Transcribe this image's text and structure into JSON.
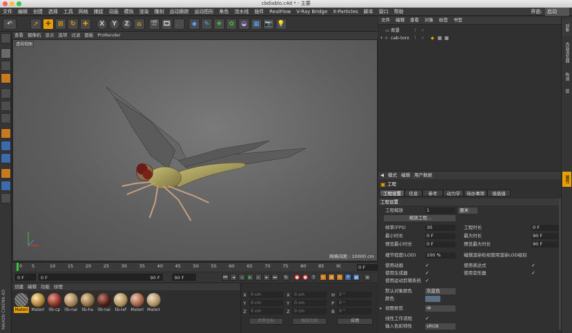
{
  "window": {
    "title": "cbdiablo.c4d * - 主要"
  },
  "menu": [
    "文件",
    "编辑",
    "创建",
    "选择",
    "工具",
    "网格",
    "捕捉",
    "动画",
    "模拟",
    "渲染",
    "雕刻",
    "运动跟踪",
    "运动图形",
    "角色",
    "流水线",
    "插件",
    "RealFlow",
    "V-Ray Bridge",
    "X-Particles",
    "脚本",
    "窗口",
    "帮助"
  ],
  "layout": {
    "label": "界面:",
    "value": "启动"
  },
  "toolbar": {
    "x": "X",
    "y": "Y",
    "z": "Z"
  },
  "viewport": {
    "menu": [
      "查看",
      "摄像机",
      "显示",
      "选项",
      "过滤",
      "面板",
      "ProRender"
    ],
    "label": "透视视图",
    "grid_spacing": "网格间距 : 10000 cm"
  },
  "timeline": {
    "ticks": [
      "0",
      "5",
      "10",
      "15",
      "20",
      "25",
      "30",
      "35",
      "40",
      "45",
      "50",
      "55",
      "60",
      "65",
      "70",
      "75",
      "80",
      "85",
      "9("
    ],
    "current_frame": "0 F"
  },
  "transport": {
    "start": "0 F",
    "start2": "0 F",
    "end": "90 F",
    "end2": "90 F"
  },
  "material_manager": {
    "menu": [
      "创建",
      "编辑",
      "功能",
      "纹理"
    ],
    "materials": [
      "Materi",
      "Materi",
      "lib-cp",
      "lib-nai",
      "lib-hu",
      "lib-nai",
      "lib-lef",
      "Materi",
      "Materi"
    ]
  },
  "coords": {
    "rows": [
      {
        "a": "X",
        "av": "0 cm",
        "b": "X",
        "bv": "0 cm",
        "c": "H",
        "cv": "0 °"
      },
      {
        "a": "Y",
        "av": "0 cm",
        "b": "Y",
        "bv": "0 cm",
        "c": "P",
        "cv": "0 °"
      },
      {
        "a": "Z",
        "av": "0 cm",
        "b": "Z",
        "bv": "0 cm",
        "c": "B",
        "cv": "0 °"
      }
    ],
    "world": "世界坐标",
    "scale": "缩放比例",
    "apply": "应用"
  },
  "object_manager": {
    "menu": [
      "文件",
      "编辑",
      "查看",
      "对象",
      "标签",
      "书签"
    ],
    "objects": [
      "背景",
      "cab-torx"
    ]
  },
  "right_tabs": [
    "对象",
    "内容浏览器",
    "构造",
    "层",
    "属性"
  ],
  "attributes": {
    "menu": [
      "模式",
      "编辑",
      "用户数据"
    ],
    "title": "工程",
    "tabs": [
      "工程设置",
      "信息",
      "参考",
      "动力学",
      "待办事项",
      "插值值"
    ],
    "section": "工程设置",
    "scale_label": "工程缩放",
    "scale_value": "1",
    "scale_unit": "厘米",
    "scale_btn": "缩放工程...",
    "fps_label": "帧率(FPS)",
    "fps": "30",
    "duration_label": "工程时长",
    "duration": "0 F",
    "min_label": "最小时长",
    "min": "0 F",
    "max_label": "最大时长",
    "max": "90 F",
    "pmin_label": "预览最小时长",
    "pmin": "0 F",
    "pmax_label": "预览最大时长",
    "pmax": "90 F",
    "lod_label": "细节程度(LOD)",
    "lod": "100 %",
    "lod_render": "编辑渲染检视使用渲染LOD级别",
    "anim_label": "使用动画",
    "expr_label": "使用表达式",
    "gen_label": "使用生成器",
    "def_label": "使用变形器",
    "mo_label": "使用运动剪辑系统",
    "defcolor_label": "默认对象颜色",
    "defcolor": "灰蓝色",
    "color_label": "颜色",
    "clip_label": "视图修剪",
    "clip": "中",
    "linear_label": "线性工作流程",
    "input_label": "输入色彩特性",
    "input": "sRGB"
  }
}
